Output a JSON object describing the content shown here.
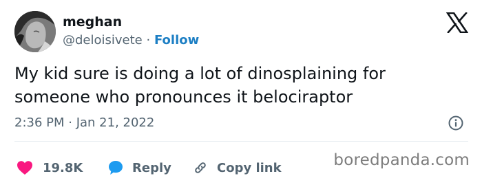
{
  "author": {
    "display_name": "meghan",
    "handle": "@deloisivete",
    "separator": "·",
    "follow_label": "Follow"
  },
  "tweet": {
    "text_lines": [
      "My kid sure is doing a lot of dinosplaining for",
      "someone who pronounces it belociraptor"
    ],
    "timestamp": "2:36 PM · Jan 21, 2022"
  },
  "actions": {
    "like_count": "19.8K",
    "reply_label": "Reply",
    "copy_label": "Copy link"
  },
  "icons": {
    "brand": "x-logo-icon",
    "info": "info-icon",
    "like": "heart-icon",
    "reply": "speech-bubble-icon",
    "copy": "link-icon"
  },
  "colors": {
    "follow": "#1d7fc4",
    "like": "#f91880",
    "reply": "#1d9bf0",
    "secondary_text": "#536471"
  },
  "watermark": "boredpanda.com"
}
